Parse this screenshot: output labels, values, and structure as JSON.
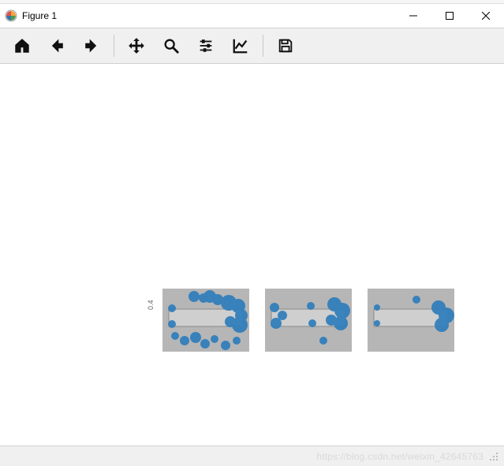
{
  "window": {
    "title": "Figure 1"
  },
  "toolbar": {
    "home_tip": "Reset original view",
    "back_tip": "Back to previous view",
    "forward_tip": "Forward to next view",
    "pan_tip": "Pan axes",
    "zoom_tip": "Zoom to rectangle",
    "subplots_tip": "Configure subplots",
    "edit_tip": "Edit axis, curve and image parameters",
    "save_tip": "Save the figure"
  },
  "status": {
    "watermark": "https://blog.csdn.net/weixin_42645763"
  },
  "chart_data": {
    "type": "image-grid",
    "ylabel": "0.4",
    "subplots": [
      {
        "index": 0,
        "description": "grayscale photo with many blue keypoint blobs scattered across and around a rectangular bracket region",
        "keypoint_count_visible": "many"
      },
      {
        "index": 1,
        "description": "grayscale photo with fewer blue keypoint blobs mostly along the bracket edges",
        "keypoint_count_visible": "moderate"
      },
      {
        "index": 2,
        "description": "grayscale photo with sparse blue keypoint blobs concentrated near right side of bracket",
        "keypoint_count_visible": "few"
      }
    ],
    "colors": {
      "keypoint": "#2f7dbb",
      "background": "#b6b6b6"
    }
  }
}
